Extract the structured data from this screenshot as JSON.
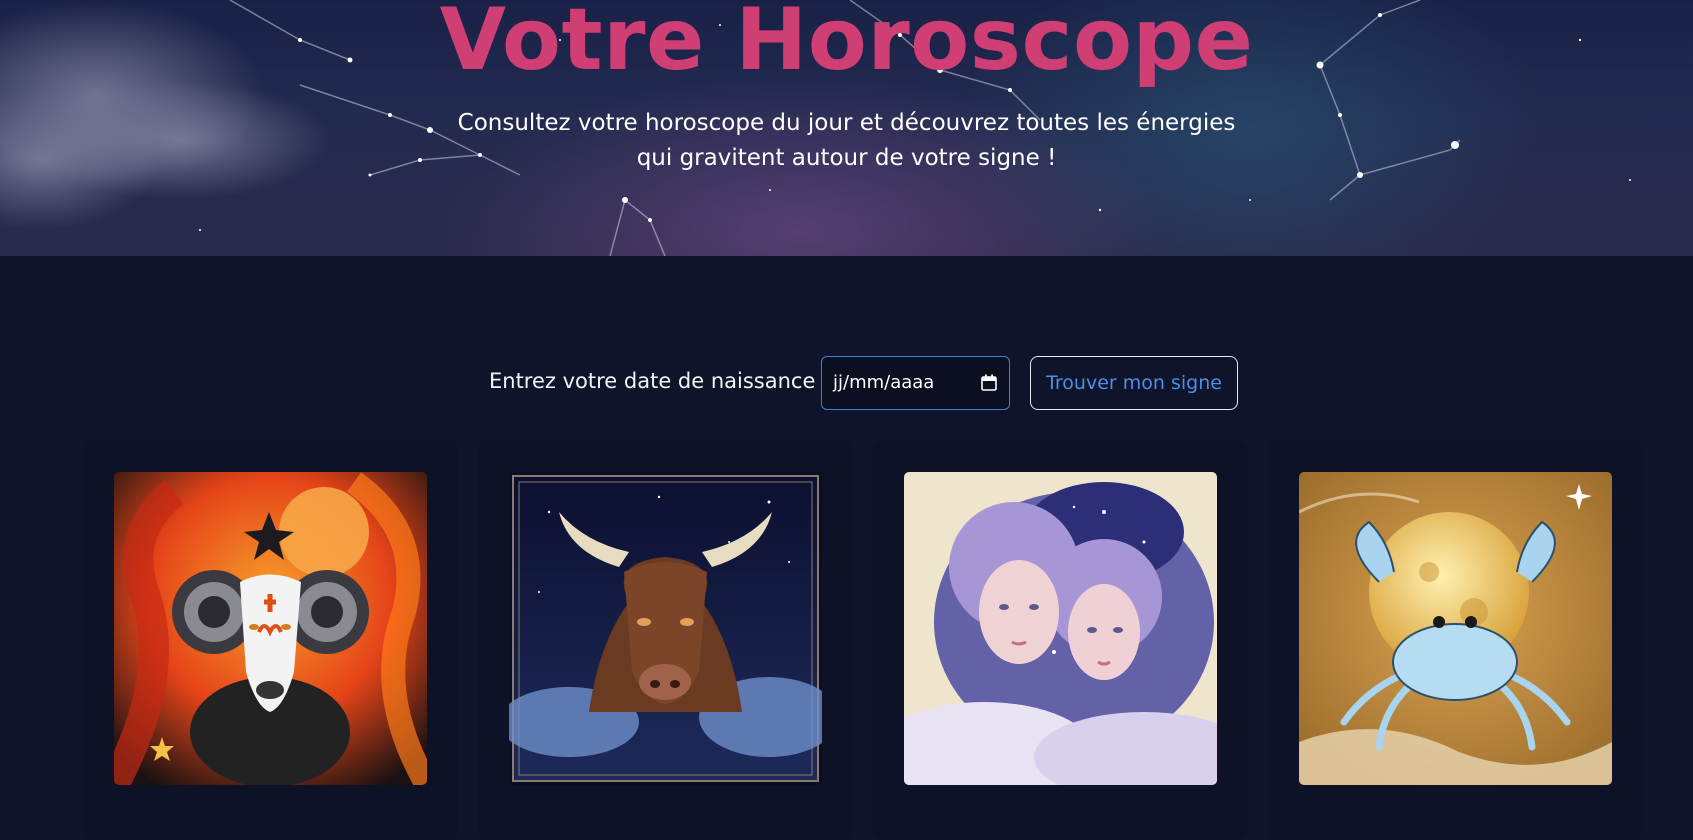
{
  "hero": {
    "title": "Votre Horoscope",
    "subtitle_line1": "Consultez votre horoscope du jour et découvrez toutes les énergies",
    "subtitle_line2": "qui gravitent autour de votre signe !"
  },
  "search": {
    "label": "Entrez votre date de naissance :",
    "date_placeholder": "jj/mm/aaaa",
    "button_label": "Trouver mon signe"
  },
  "signs": [
    {
      "image": "aries-ram-illustration"
    },
    {
      "image": "taurus-bull-illustration"
    },
    {
      "image": "gemini-twins-illustration"
    },
    {
      "image": "cancer-crab-illustration"
    }
  ],
  "colors": {
    "background": "#10142a",
    "title": "#cf3f74",
    "input_border": "#3b82d6",
    "button_text": "#4d8ee6"
  }
}
